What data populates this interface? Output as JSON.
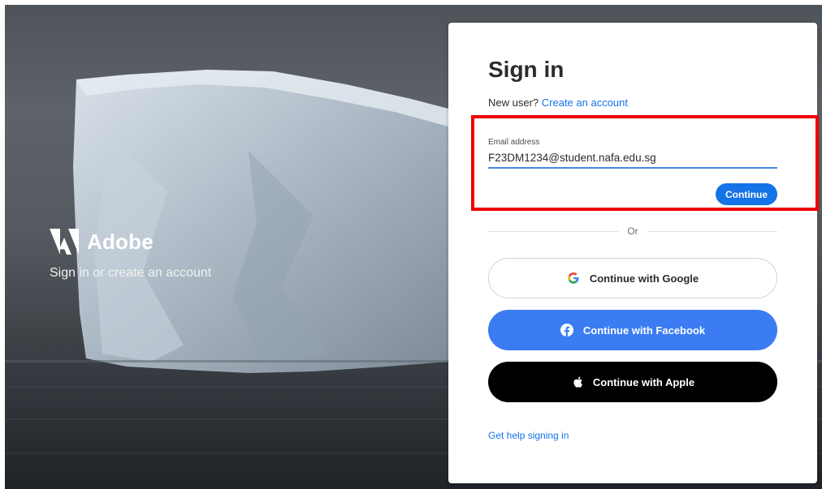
{
  "brand": {
    "name": "Adobe",
    "tagline": "Sign in or create an account",
    "logo_icon": "adobe-logo-icon"
  },
  "signin": {
    "title": "Sign in",
    "new_user_text": "New user?",
    "create_account_link": "Create an account",
    "email_label": "Email address",
    "email_value": "F23DM1234@student.nafa.edu.sg",
    "continue_label": "Continue",
    "divider_text": "Or",
    "google_label": "Continue with Google",
    "facebook_label": "Continue with Facebook",
    "apple_label": "Continue with Apple",
    "help_link": "Get help signing in"
  },
  "icons": {
    "google": "google-icon",
    "facebook": "facebook-icon",
    "apple": "apple-icon"
  },
  "colors": {
    "accent": "#1473e6",
    "highlight": "#ee0000",
    "facebook": "#3b7cf3",
    "apple": "#000000"
  }
}
